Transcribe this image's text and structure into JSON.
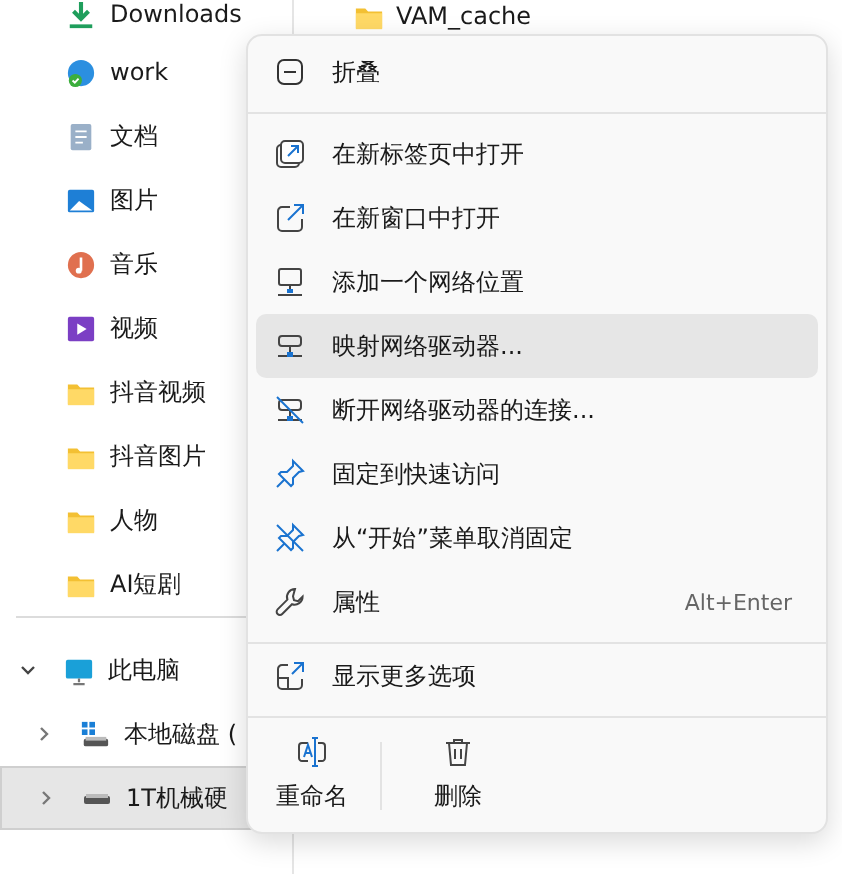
{
  "sidebar": {
    "quick_access": [
      {
        "label": "Downloads",
        "selected": false
      },
      {
        "label": "work",
        "selected": false
      },
      {
        "label": "文档",
        "selected": false
      },
      {
        "label": "图片",
        "selected": false
      },
      {
        "label": "音乐",
        "selected": false
      },
      {
        "label": "视频",
        "selected": false
      },
      {
        "label": "抖音视频",
        "selected": false
      },
      {
        "label": "抖音图片",
        "selected": false
      },
      {
        "label": "人物",
        "selected": false
      },
      {
        "label": "AI短剧",
        "selected": false
      }
    ],
    "this_pc": {
      "label": "此电脑",
      "expanded": true,
      "selected": false,
      "children": [
        {
          "label": "本地磁盘 (",
          "expanded": false,
          "selected": false
        },
        {
          "label": "1T机械硬",
          "expanded": false,
          "selected": true
        }
      ]
    }
  },
  "file_list": {
    "items": [
      {
        "name": "VAM_cache"
      }
    ]
  },
  "context_menu": {
    "sections": [
      [
        {
          "label": "折叠",
          "hovered": false
        }
      ],
      [
        {
          "label": "在新标签页中打开",
          "hovered": false
        },
        {
          "label": "在新窗口中打开",
          "hovered": false
        },
        {
          "label": "添加一个网络位置",
          "hovered": false
        },
        {
          "label": "映射网络驱动器...",
          "hovered": true
        },
        {
          "label": "断开网络驱动器的连接...",
          "hovered": false
        },
        {
          "label": "固定到快速访问",
          "hovered": false
        },
        {
          "label": "从“开始”菜单取消固定",
          "hovered": false
        },
        {
          "label": "属性",
          "hovered": false,
          "shortcut": "Alt+Enter"
        }
      ],
      [
        {
          "label": "显示更多选项",
          "hovered": false
        }
      ]
    ],
    "actions": [
      {
        "label": "重命名"
      },
      {
        "label": "删除"
      }
    ]
  }
}
